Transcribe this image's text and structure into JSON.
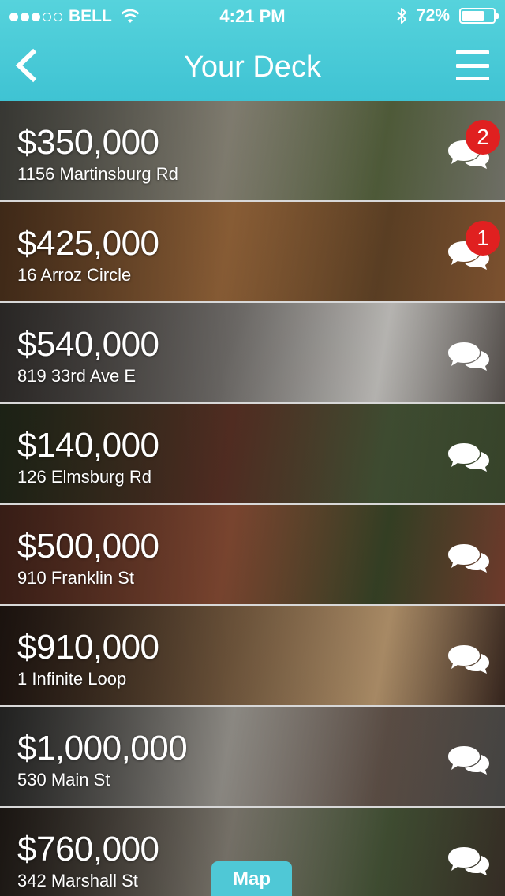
{
  "status_bar": {
    "carrier": "BELL",
    "time": "4:21 PM",
    "battery": "72%",
    "battery_level": 0.72,
    "signal_bars_filled": 3,
    "signal_bars_total": 5
  },
  "nav": {
    "title": "Your Deck",
    "back_icon": "chevron-left-icon",
    "menu_icon": "hamburger-menu-icon"
  },
  "listings": [
    {
      "price": "$350,000",
      "address": "1156 Martinsburg Rd",
      "badge": "2",
      "colors": [
        "#7a7a70",
        "#a8a392",
        "#5d6b43"
      ]
    },
    {
      "price": "$425,000",
      "address": "16 Arroz Circle",
      "badge": "1",
      "colors": [
        "#8a5a34",
        "#b47a46",
        "#6b4a2a"
      ]
    },
    {
      "price": "$540,000",
      "address": "819 33rd Ave E",
      "badge": "",
      "colors": [
        "#5a5450",
        "#8a8682",
        "#d8d6d2"
      ]
    },
    {
      "price": "$140,000",
      "address": "126 Elmsburg Rd",
      "badge": "",
      "colors": [
        "#3c4a2e",
        "#6a3a2c",
        "#4a5a3a"
      ]
    },
    {
      "price": "$500,000",
      "address": "910 Franklin St",
      "badge": "",
      "colors": [
        "#7a4030",
        "#a05a3e",
        "#3d4a2a"
      ]
    },
    {
      "price": "$910,000",
      "address": "1 Infinite Loop",
      "badge": "",
      "colors": [
        "#3a2820",
        "#8a6a4a",
        "#c8a478"
      ]
    },
    {
      "price": "$1,000,000",
      "address": "530 Main St",
      "badge": "",
      "colors": [
        "#4a4a48",
        "#b8b4ac",
        "#6a5a50"
      ]
    },
    {
      "price": "$760,000",
      "address": "342 Marshall St",
      "badge": "",
      "colors": [
        "#3a3028",
        "#9a9488",
        "#4a5a3a"
      ]
    }
  ],
  "map_button": {
    "label": "Map"
  },
  "colors": {
    "header": "#47c8d6",
    "badge": "#e02020",
    "map_button": "#4fc8d6"
  }
}
